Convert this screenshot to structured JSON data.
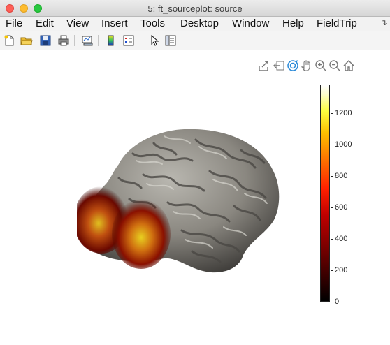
{
  "window": {
    "title": "5: ft_sourceplot: source"
  },
  "menu": {
    "items": [
      "File",
      "Edit",
      "View",
      "Insert",
      "Tools",
      "Desktop",
      "Window",
      "Help",
      "FieldTrip"
    ],
    "overflow_icon": "double-chevron-icon"
  },
  "toolbar": {
    "icons": [
      "new-figure-icon",
      "open-file-icon",
      "save-icon",
      "print-icon",
      "link-plot-icon",
      "insert-colorbar-icon",
      "insert-legend-icon",
      "edit-plot-icon",
      "property-inspector-icon"
    ]
  },
  "axes_toolbar": {
    "icons": [
      "export-icon",
      "brush-icon",
      "rotate-3d-icon",
      "pan-icon",
      "zoom-in-icon",
      "zoom-out-icon",
      "home-icon"
    ]
  },
  "colormap": {
    "colors": [
      "#000000",
      "#7a0000",
      "#ff2000",
      "#ff7000",
      "#ffff40",
      "#ffffff"
    ]
  },
  "brain": {
    "cortex_color": "#8a8780",
    "activation_color": "#c83010"
  },
  "chart_data": {
    "type": "heatmap",
    "title": "",
    "xlabel": "",
    "ylabel": "",
    "colorbar": {
      "ylim": [
        0,
        1380
      ],
      "ticks": [
        0,
        200,
        400,
        600,
        800,
        1000,
        1200
      ],
      "tick_labels": [
        "0",
        "200",
        "400",
        "600",
        "800",
        "1000",
        "1200"
      ]
    }
  }
}
